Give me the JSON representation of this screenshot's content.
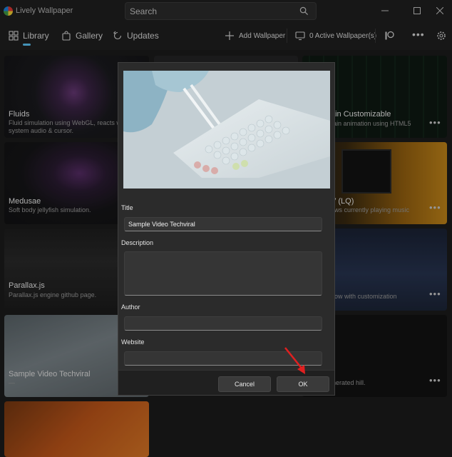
{
  "app": {
    "title": "Lively Wallpaper"
  },
  "search": {
    "placeholder": "Search"
  },
  "nav": {
    "library": "Library",
    "gallery": "Gallery",
    "updates": "Updates",
    "add_wallpaper": "Add Wallpaper",
    "active_wallpapers": "0 Active Wallpaper(s)",
    "more": "•••"
  },
  "cards": [
    {
      "title": "Fluids",
      "desc": "Fluid simulation using WebGL, reacts with\nsystem audio & cursor."
    },
    {
      "title": "Medusae",
      "desc": "Soft body jellyfish simulation."
    },
    {
      "title": "Parallax.js",
      "desc": "Parallax.js engine github page."
    },
    {
      "title": "Sample Video Techviral",
      "desc": "—"
    },
    {
      "title": "ain Customizable",
      "desc": "rain animation using HTML5"
    },
    {
      "title": "V (LQ)",
      "desc": "ows currently playing music"
    },
    {
      "title": "",
      "desc": "dow with customization"
    },
    {
      "title": "",
      "desc": "nerated hill."
    }
  ],
  "card_more": "•••",
  "dialog": {
    "title_label": "Title",
    "title_value": "Sample Video Techviral",
    "description_label": "Description",
    "description_value": "",
    "author_label": "Author",
    "author_value": "",
    "website_label": "Website",
    "website_value": "",
    "cancel": "Cancel",
    "ok": "OK"
  },
  "colors": {
    "accent": "#60cdff",
    "annotation_arrow": "#e02020"
  }
}
